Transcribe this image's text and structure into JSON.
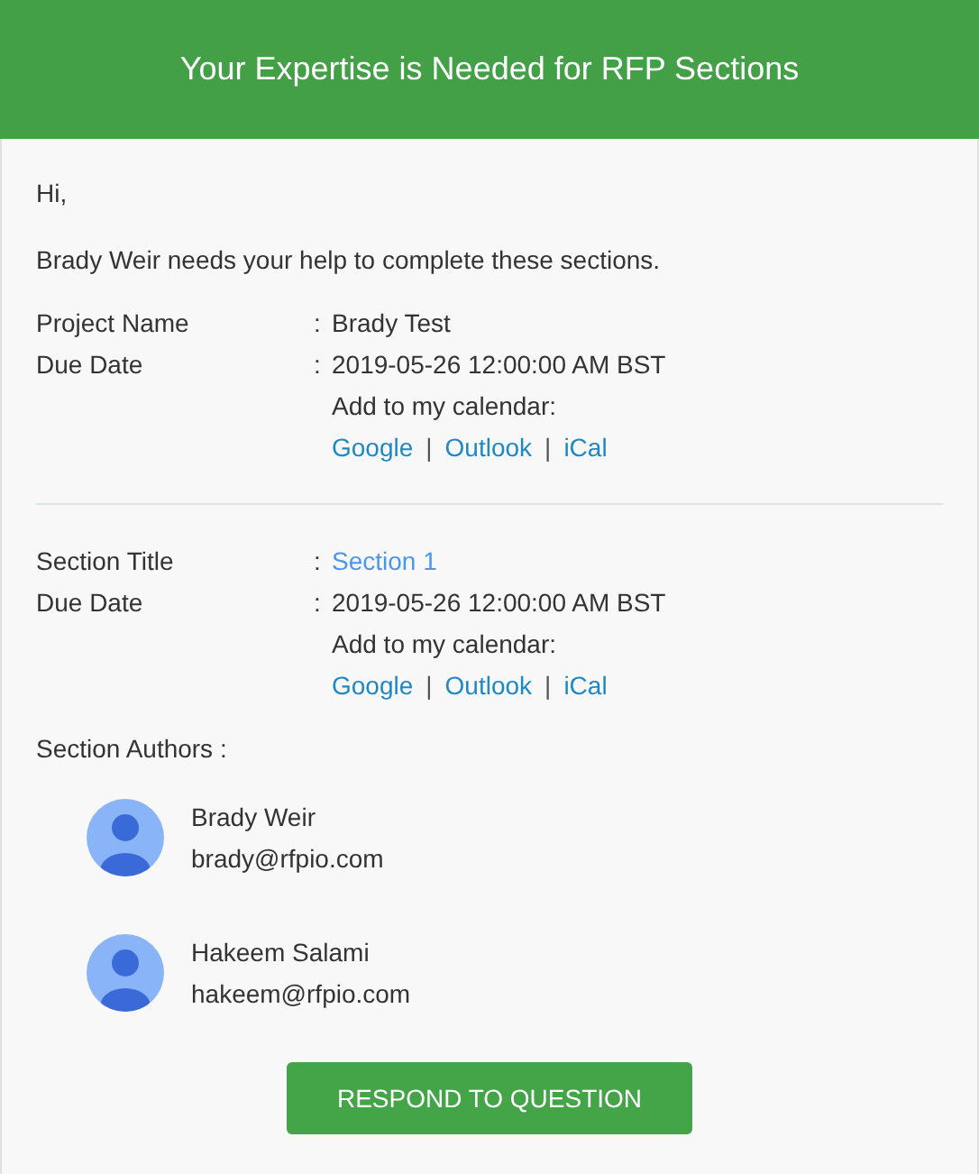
{
  "header": {
    "title": "Your Expertise is Needed for RFP Sections"
  },
  "greeting": "Hi,",
  "intro": "Brady Weir needs your help to complete these sections.",
  "project": {
    "fields": [
      {
        "label": "Project Name",
        "separator": ":",
        "value": "Brady Test",
        "kind": "text"
      },
      {
        "label": "Due Date",
        "separator": ":",
        "value": "2019-05-26 12:00:00 AM BST",
        "kind": "text"
      }
    ],
    "calendar": {
      "label": "Add to my calendar:",
      "links": [
        "Google",
        "Outlook",
        "iCal"
      ],
      "divider": "|"
    }
  },
  "section": {
    "fields": [
      {
        "label": "Section Title",
        "separator": ":",
        "value": "Section 1",
        "kind": "link"
      },
      {
        "label": "Due Date",
        "separator": ":",
        "value": "2019-05-26 12:00:00 AM BST",
        "kind": "text"
      }
    ],
    "calendar": {
      "label": "Add to my calendar:",
      "links": [
        "Google",
        "Outlook",
        "iCal"
      ],
      "divider": "|"
    }
  },
  "authors": {
    "label": "Section Authors :",
    "items": [
      {
        "name": "Brady Weir",
        "email": "brady@rfpio.com"
      },
      {
        "name": "Hakeem Salami",
        "email": "hakeem@rfpio.com"
      }
    ]
  },
  "button": {
    "label": "RESPOND TO QUESTION"
  }
}
